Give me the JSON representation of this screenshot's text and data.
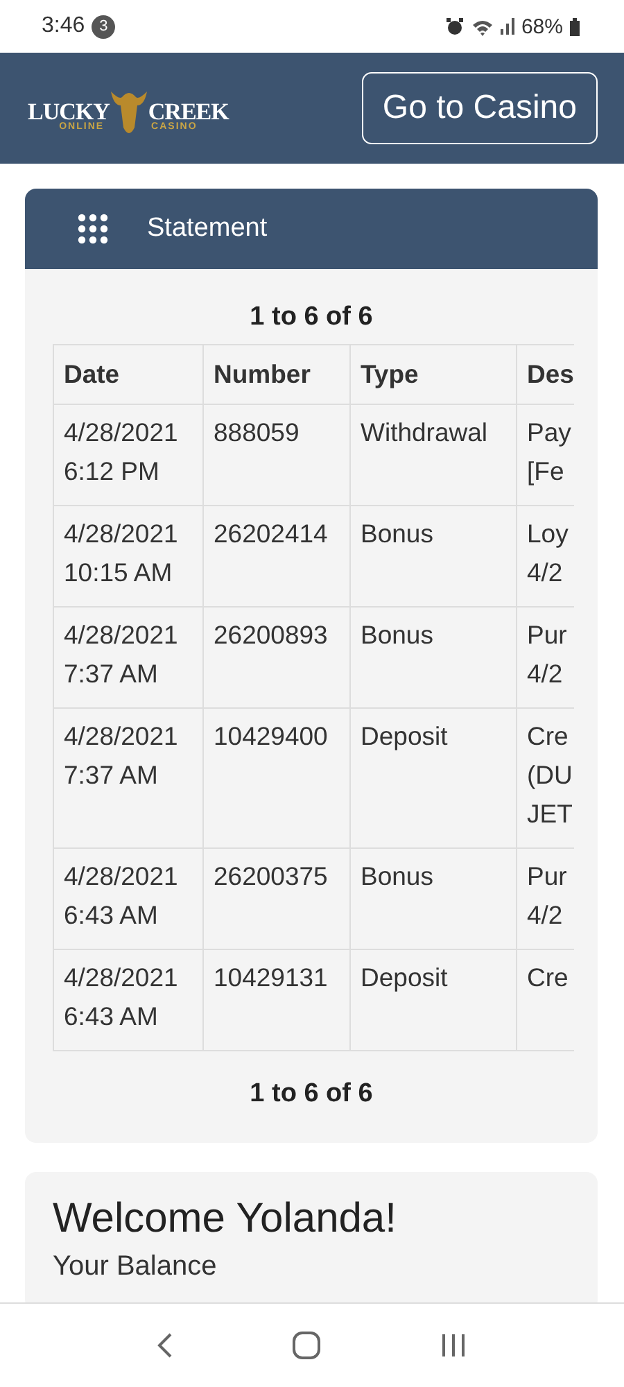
{
  "status_bar": {
    "time": "3:46",
    "notification_count": "3",
    "battery": "68%"
  },
  "header": {
    "logo": {
      "line_1": "LUCKY",
      "line_2": "CREEK",
      "tagline_1": "ONLINE",
      "tagline_2": "CASINO"
    },
    "button": "Go to Casino"
  },
  "statement": {
    "title": "Statement",
    "pager_top": "1 to 6 of 6",
    "pager_bottom": "1 to 6 of 6",
    "columns": [
      "Date",
      "Number",
      "Type",
      "Des"
    ],
    "rows": [
      {
        "date": [
          "4/28/2021",
          "6:12 PM"
        ],
        "number": "888059",
        "type": "Withdrawal",
        "column_4": [
          "Pay",
          "[Fe"
        ]
      },
      {
        "date": [
          "4/28/2021",
          "10:15 AM"
        ],
        "number": "26202414",
        "type": "Bonus",
        "column_4": [
          "Loy",
          "4/2"
        ]
      },
      {
        "date": [
          "4/28/2021",
          "7:37 AM"
        ],
        "number": "26200893",
        "type": "Bonus",
        "column_4": [
          "Pur",
          "4/2"
        ]
      },
      {
        "date": [
          "4/28/2021",
          "7:37 AM"
        ],
        "number": "10429400",
        "type": "Deposit",
        "column_4": [
          "Cre",
          "(DU",
          "JET"
        ]
      },
      {
        "date": [
          "4/28/2021",
          "6:43 AM"
        ],
        "number": "26200375",
        "type": "Bonus",
        "column_4": [
          "Pur",
          "4/2"
        ]
      },
      {
        "date": [
          "4/28/2021",
          "6:43 AM"
        ],
        "number": "10429131",
        "type": "Deposit",
        "column_4": [
          "Cre"
        ]
      }
    ]
  },
  "welcome": {
    "title": "Welcome Yolanda!",
    "subtitle": "Your Balance"
  }
}
